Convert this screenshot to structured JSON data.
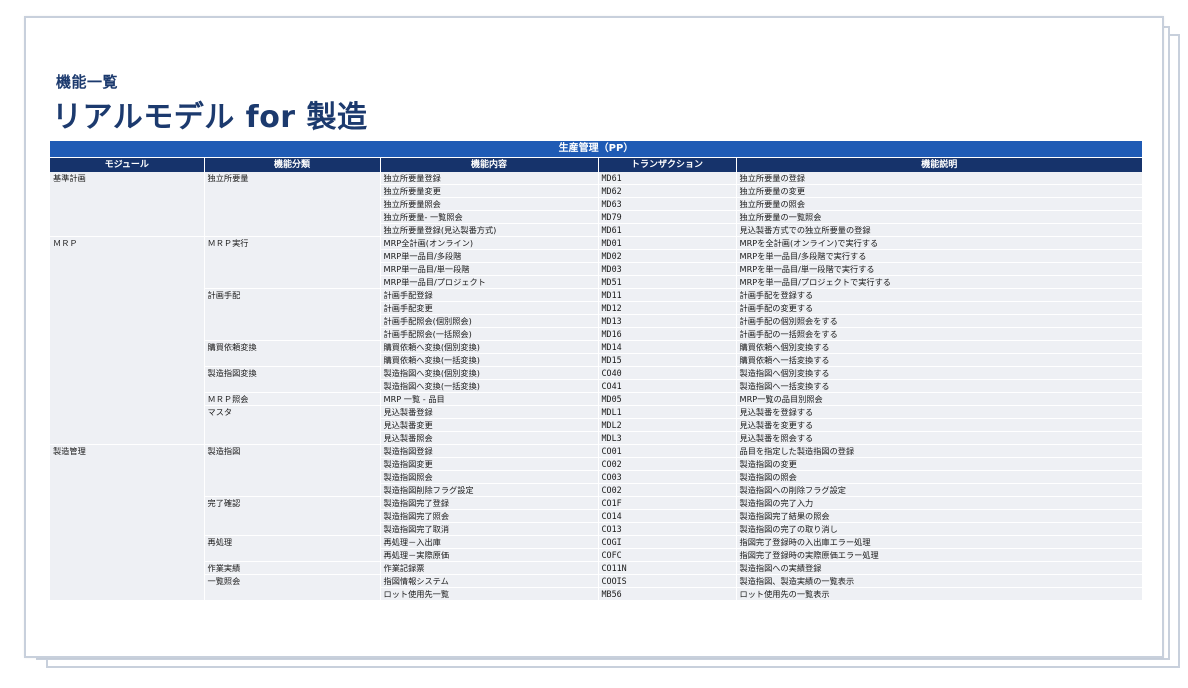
{
  "header": {
    "subtitle": "機能一覧",
    "title": "リアルモデル for 製造"
  },
  "table": {
    "banner": "生産管理（PP）",
    "columns": [
      "モジュール",
      "機能分類",
      "機能内容",
      "トランザクション",
      "機能説明"
    ],
    "rows": [
      {
        "module": "基準計画",
        "category": "独立所要量",
        "content": "独立所要量登録",
        "tcode": "MD61",
        "desc": "独立所要量の登録"
      },
      {
        "module": "",
        "category": "",
        "content": "独立所要量変更",
        "tcode": "MD62",
        "desc": "独立所要量の変更"
      },
      {
        "module": "",
        "category": "",
        "content": "独立所要量照会",
        "tcode": "MD63",
        "desc": "独立所要量の照会"
      },
      {
        "module": "",
        "category": "",
        "content": "独立所要量- 一覧照会",
        "tcode": "MD79",
        "desc": "独立所要量の一覧照会"
      },
      {
        "module": "",
        "category": "",
        "content": "独立所要量登録(見込製番方式)",
        "tcode": "MD61",
        "desc": "見込製番方式での独立所要量の登録"
      },
      {
        "module": "ＭＲＰ",
        "category": "ＭＲＰ実行",
        "content": "MRP全計画(オンライン)",
        "tcode": "MD01",
        "desc": "MRPを全計画(オンライン)で実行する"
      },
      {
        "module": "",
        "category": "",
        "content": "MRP単一品目/多段階",
        "tcode": "MD02",
        "desc": "MRPを単一品目/多段階で実行する"
      },
      {
        "module": "",
        "category": "",
        "content": "MRP単一品目/単一段階",
        "tcode": "MD03",
        "desc": "MRPを単一品目/単一段階で実行する"
      },
      {
        "module": "",
        "category": "",
        "content": "MRP単一品目/プロジェクト",
        "tcode": "MD51",
        "desc": "MRPを単一品目/プロジェクトで実行する"
      },
      {
        "module": "",
        "category": "計画手配",
        "content": "計画手配登録",
        "tcode": "MD11",
        "desc": "計画手配を登録する"
      },
      {
        "module": "",
        "category": "",
        "content": "計画手配変更",
        "tcode": "MD12",
        "desc": "計画手配の変更する"
      },
      {
        "module": "",
        "category": "",
        "content": "計画手配照会(個別照会)",
        "tcode": "MD13",
        "desc": "計画手配の個別照会をする"
      },
      {
        "module": "",
        "category": "",
        "content": "計画手配照会(一括照会)",
        "tcode": "MD16",
        "desc": "計画手配の一括照会をする"
      },
      {
        "module": "",
        "category": "購買依頼変換",
        "content": "購買依頼へ変換(個別変換)",
        "tcode": "MD14",
        "desc": "購買依頼へ個別変換する"
      },
      {
        "module": "",
        "category": "",
        "content": "購買依頼へ変換(一括変換)",
        "tcode": "MD15",
        "desc": "購買依頼へ一括変換する"
      },
      {
        "module": "",
        "category": "製造指図変換",
        "content": "製造指図へ変換(個別変換)",
        "tcode": "CO40",
        "desc": "製造指図へ個別変換する"
      },
      {
        "module": "",
        "category": "",
        "content": "製造指図へ変換(一括変換)",
        "tcode": "CO41",
        "desc": "製造指図へ一括変換する"
      },
      {
        "module": "",
        "category": "ＭＲＰ照会",
        "content": "MRP 一覧 - 品目",
        "tcode": "MD05",
        "desc": "MRP一覧の品目別照会"
      },
      {
        "module": "",
        "category": "マスタ",
        "content": "見込製番登録",
        "tcode": "MDL1",
        "desc": "見込製番を登録する"
      },
      {
        "module": "",
        "category": "",
        "content": "見込製番変更",
        "tcode": "MDL2",
        "desc": "見込製番を変更する"
      },
      {
        "module": "",
        "category": "",
        "content": "見込製番照会",
        "tcode": "MDL3",
        "desc": "見込製番を照会する"
      },
      {
        "module": "製造管理",
        "category": "製造指図",
        "content": "製造指図登録",
        "tcode": "CO01",
        "desc": "品目を指定した製造指図の登録"
      },
      {
        "module": "",
        "category": "",
        "content": "製造指図変更",
        "tcode": "CO02",
        "desc": "製造指図の変更"
      },
      {
        "module": "",
        "category": "",
        "content": "製造指図照会",
        "tcode": "CO03",
        "desc": "製造指図の照会"
      },
      {
        "module": "",
        "category": "",
        "content": "製造指図削除フラグ設定",
        "tcode": "CO02",
        "desc": "製造指図への削除フラグ設定"
      },
      {
        "module": "",
        "category": "完了確認",
        "content": "製造指図完了登録",
        "tcode": "CO1F",
        "desc": "製造指図の完了入力"
      },
      {
        "module": "",
        "category": "",
        "content": "製造指図完了照会",
        "tcode": "CO14",
        "desc": "製造指図完了結果の照会"
      },
      {
        "module": "",
        "category": "",
        "content": "製造指図完了取消",
        "tcode": "CO13",
        "desc": "製造指図の完了の取り消し"
      },
      {
        "module": "",
        "category": "再処理",
        "content": "再処理－入出庫",
        "tcode": "COGI",
        "desc": "指図完了登録時の入出庫エラー処理"
      },
      {
        "module": "",
        "category": "",
        "content": "再処理－実際原価",
        "tcode": "COFC",
        "desc": "指図完了登録時の実際原価エラー処理"
      },
      {
        "module": "",
        "category": "作業実績",
        "content": "作業記録票",
        "tcode": "CO11N",
        "desc": "製造指図への実績登録"
      },
      {
        "module": "",
        "category": "一覧照会",
        "content": "指図情報システム",
        "tcode": "COOIS",
        "desc": "製造指図、製造実績の一覧表示"
      },
      {
        "module": "",
        "category": "",
        "content": "ロット使用先一覧",
        "tcode": "MB56",
        "desc": "ロット使用先の一覧表示"
      }
    ]
  }
}
